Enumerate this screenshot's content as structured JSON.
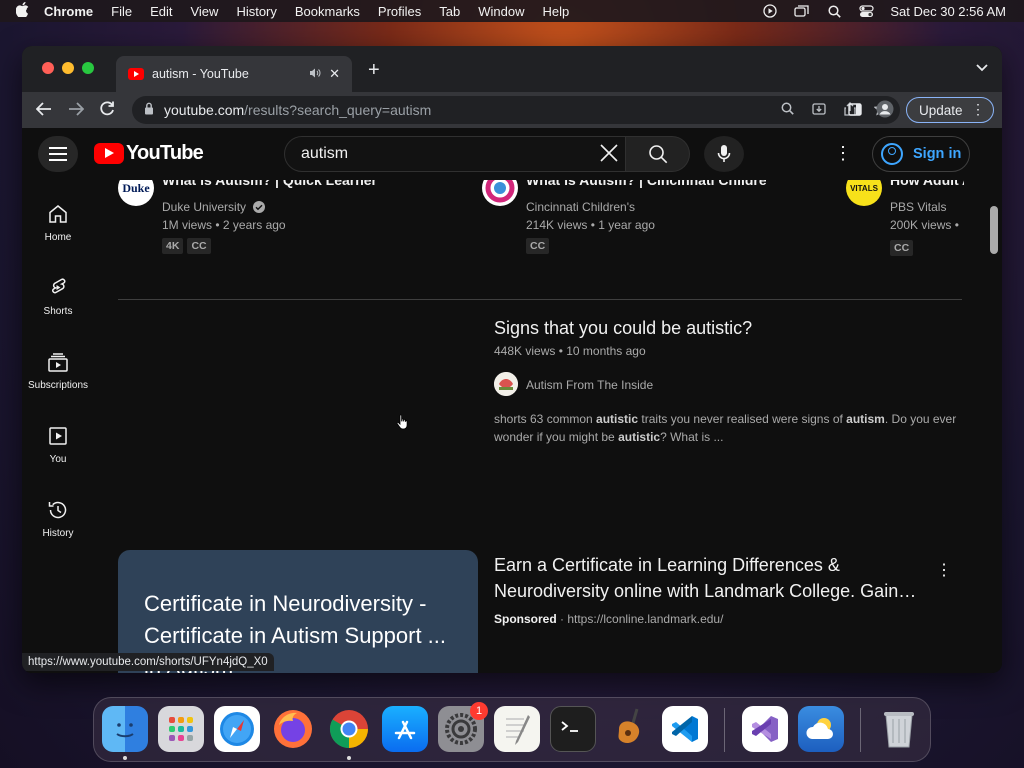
{
  "menubar": {
    "app": "Chrome",
    "items": [
      "File",
      "Edit",
      "View",
      "History",
      "Bookmarks",
      "Profiles",
      "Tab",
      "Window",
      "Help"
    ],
    "clock": "Sat Dec 30  2:56 AM"
  },
  "browser": {
    "tab_title": "autism - YouTube",
    "url_host": "youtube.com",
    "url_path": "/results?search_query=autism",
    "update_label": "Update",
    "status_url": "https://www.youtube.com/shorts/UFYn4jdQ_X0"
  },
  "youtube": {
    "logo_text": "YouTube",
    "search_value": "autism",
    "signin_label": "Sign in",
    "sidebar": [
      {
        "label": "Home",
        "icon": "home-icon"
      },
      {
        "label": "Shorts",
        "icon": "shorts-icon"
      },
      {
        "label": "Subscriptions",
        "icon": "subscriptions-icon"
      },
      {
        "label": "You",
        "icon": "you-icon"
      },
      {
        "label": "History",
        "icon": "history-icon"
      }
    ],
    "top_cards": [
      {
        "title": "What is Autism? | Quick Learner",
        "channel": "Duke University",
        "verified": true,
        "views": "1M views",
        "age": "2 years ago",
        "badges": [
          "4K",
          "CC"
        ],
        "avatar_text": "Duke"
      },
      {
        "title": "What is Autism? | Cincinnati Children's",
        "channel": "Cincinnati Children's",
        "verified": false,
        "views": "214K views",
        "age": "1 year ago",
        "badges": [
          "CC"
        ],
        "avatar_text": ""
      },
      {
        "title": "How Adult A",
        "channel": "PBS Vitals",
        "verified": false,
        "views": "200K views",
        "age": "",
        "badges": [
          "CC"
        ],
        "avatar_text": "VITALS"
      }
    ],
    "result": {
      "title": "Signs that you could be autistic?",
      "views": "448K views",
      "age": "10 months ago",
      "channel": "Autism From The Inside",
      "desc_1": "shorts 63 common ",
      "desc_b1": "autistic",
      "desc_2": " traits you never realised were signs of ",
      "desc_b2": "autism",
      "desc_3": ". Do you ever wonder if you might be ",
      "desc_b3": "autistic",
      "desc_4": "? What is ..."
    },
    "ad": {
      "thumb_text": "Certificate in Neurodiversity - Certificate in Autism Support ... in Autism",
      "title": "Earn a Certificate in Learning Differences & Neurodiversity online with Landmark College. Gain…",
      "sponsored": "Sponsored",
      "url": "https://lconline.landmark.edu/"
    }
  },
  "dock": {
    "apps": [
      "finder-icon",
      "launchpad-icon",
      "safari-icon",
      "firefox-icon",
      "chrome-icon",
      "app-store-icon",
      "system-settings-icon",
      "textedit-icon",
      "terminal-icon",
      "garageband-icon",
      "vscode-icon",
      "visual-studio-icon",
      "weather-icon",
      "trash-icon"
    ],
    "settings_badge": "1"
  }
}
